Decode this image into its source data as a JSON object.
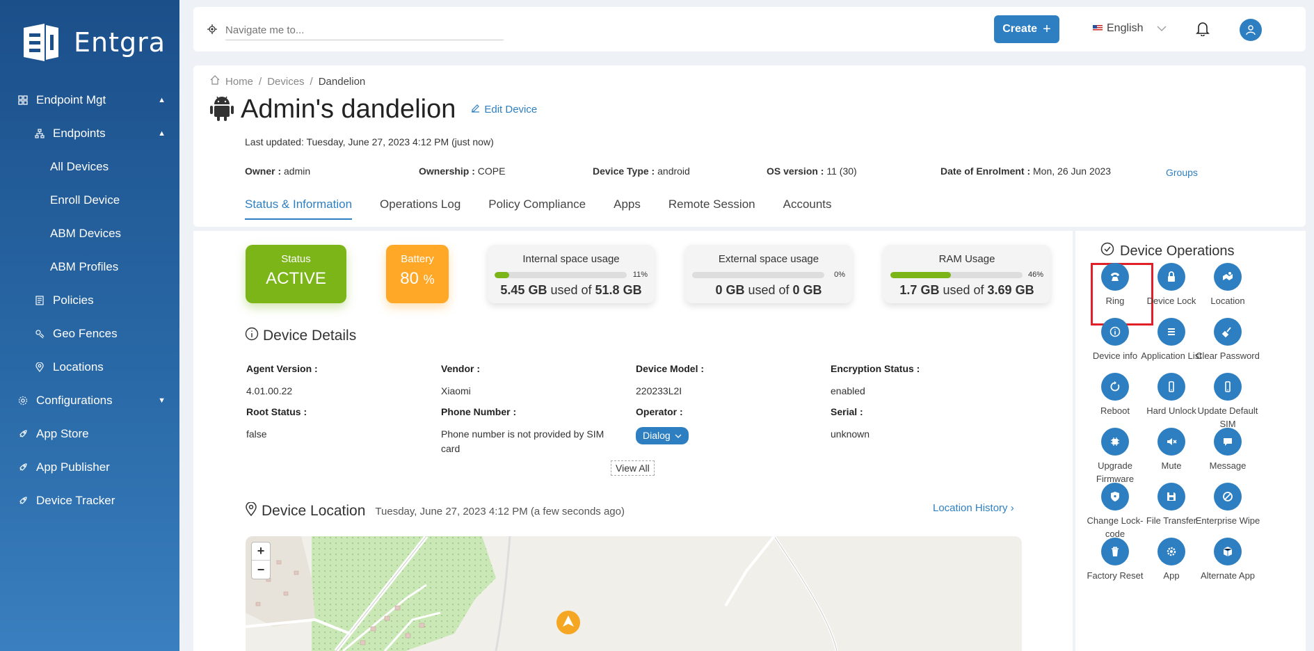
{
  "sidebar": {
    "logo_text": "Entgra",
    "items": [
      {
        "label": "Endpoint Mgt"
      },
      {
        "label": "Endpoints"
      },
      {
        "label": "All Devices"
      },
      {
        "label": "Enroll Device"
      },
      {
        "label": "ABM Devices"
      },
      {
        "label": "ABM Profiles"
      },
      {
        "label": "Policies"
      },
      {
        "label": "Geo Fences"
      },
      {
        "label": "Locations"
      },
      {
        "label": "Configurations"
      },
      {
        "label": "App Store"
      },
      {
        "label": "App Publisher"
      },
      {
        "label": "Device Tracker"
      }
    ]
  },
  "topbar": {
    "search_placeholder": "Navigate me to...",
    "create_label": "Create",
    "language": "English"
  },
  "breadcrumb": {
    "home": "Home",
    "devices": "Devices",
    "current": "Dandelion"
  },
  "device": {
    "title": "Admin's dandelion",
    "edit_label": "Edit Device",
    "last_updated": "Last updated: Tuesday, June 27, 2023 4:12 PM (just now)",
    "owner_label": "Owner :",
    "owner": "admin",
    "ownership_label": "Ownership :",
    "ownership": "COPE",
    "type_label": "Device Type :",
    "type": "android",
    "os_label": "OS version :",
    "os": "11 (30)",
    "enrol_label": "Date of Enrolment :",
    "enrol": "Mon, 26 Jun 2023",
    "groups_label": "Groups"
  },
  "tabs": [
    "Status & Information",
    "Operations Log",
    "Policy Compliance",
    "Apps",
    "Remote Session",
    "Accounts"
  ],
  "stats": {
    "status_label": "Status",
    "status": "ACTIVE",
    "battery_label": "Battery",
    "battery": "80",
    "battery_unit": "%",
    "internal": {
      "label": "Internal space usage",
      "pct": "11%",
      "fill": 11,
      "used": "5.45 GB",
      "total": "51.8 GB"
    },
    "external": {
      "label": "External space usage",
      "pct": "0%",
      "fill": 0,
      "used": "0 GB",
      "total": "0 GB"
    },
    "ram": {
      "label": "RAM Usage",
      "pct": "46%",
      "fill": 46,
      "used": "1.7 GB",
      "total": "3.69 GB"
    },
    "used_of": "used of"
  },
  "details": {
    "title": "Device Details",
    "agent_k": "Agent Version",
    "agent_v": "4.01.00.22",
    "vendor_k": "Vendor",
    "vendor_v": "Xiaomi",
    "model_k": "Device Model",
    "model_v": "220233L2I",
    "enc_k": "Encryption Status",
    "enc_v": "enabled",
    "root_k": "Root Status",
    "root_v": "false",
    "phone_k": "Phone Number",
    "phone_v": "Phone number is not provided by SIM card",
    "operator_k": "Operator",
    "operator_v": "Dialog",
    "serial_k": "Serial",
    "serial_v": "unknown",
    "view_all": "View All"
  },
  "location": {
    "title": "Device Location",
    "time": "Tuesday, June 27, 2023 4:12 PM (a few seconds ago)",
    "history": "Location History"
  },
  "operations": {
    "title": "Device Operations",
    "items": [
      {
        "label": "Ring",
        "icon": "phone-icon"
      },
      {
        "label": "Device Lock",
        "icon": "lock-icon"
      },
      {
        "label": "Location",
        "icon": "map-icon"
      },
      {
        "label": "Device info",
        "icon": "info-icon"
      },
      {
        "label": "Application List",
        "icon": "list-icon"
      },
      {
        "label": "Clear Password",
        "icon": "broom-icon"
      },
      {
        "label": "Reboot",
        "icon": "reboot-icon"
      },
      {
        "label": "Hard Unlock",
        "icon": "mobile-icon"
      },
      {
        "label": "Update Default SIM",
        "icon": "mobile-icon"
      },
      {
        "label": "Upgrade Firmware",
        "icon": "chip-icon"
      },
      {
        "label": "Mute",
        "icon": "mute-icon"
      },
      {
        "label": "Message",
        "icon": "message-icon"
      },
      {
        "label": "Change Lock-code",
        "icon": "shield-icon"
      },
      {
        "label": "File Transfer",
        "icon": "save-icon"
      },
      {
        "label": "Enterprise Wipe",
        "icon": "block-icon"
      },
      {
        "label": "Factory Reset",
        "icon": "trash-icon"
      },
      {
        "label": "App",
        "icon": "gear-icon"
      },
      {
        "label": "Alternate App",
        "icon": "box-icon"
      }
    ]
  }
}
